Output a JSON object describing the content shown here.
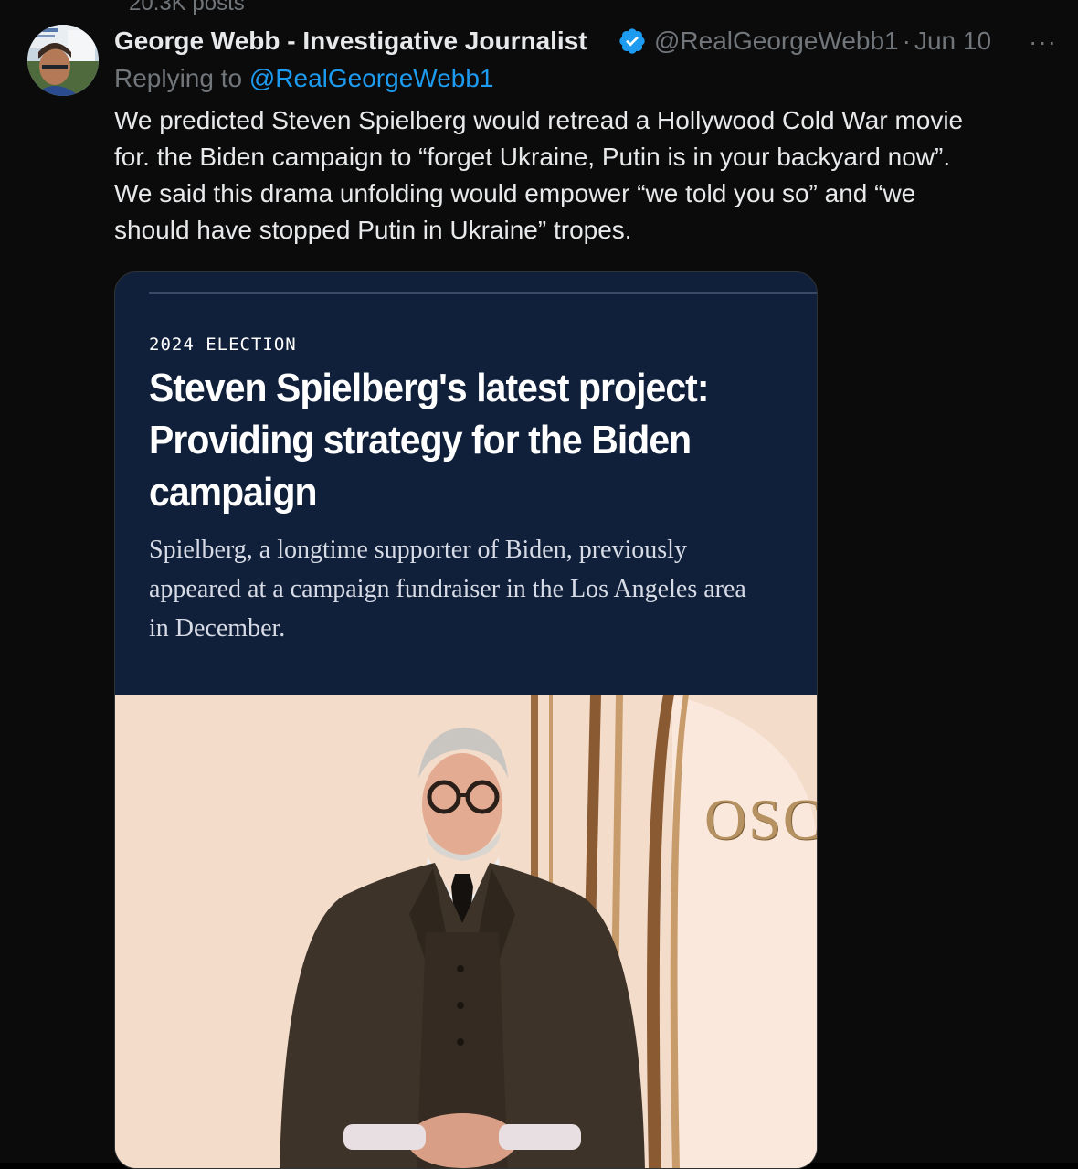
{
  "top": {
    "post_count": "20.3K posts"
  },
  "tweet": {
    "display_name": "George Webb - Investigative Journalist",
    "handle": "@RealGeorgeWebb1",
    "separator": "·",
    "date": "Jun 10",
    "more_glyph": "···",
    "reply_prefix": "Replying to ",
    "reply_mention": "@RealGeorgeWebb1",
    "body_lines": [
      "We predicted Steven Spielberg would retread a Hollywood Cold War movie",
      "for. the Biden campaign to “forget Ukraine, Putin is in your backyard now”.",
      "We said this drama unfolding would empower “we told you so” and “we",
      "should have stopped Putin in Ukraine” tropes."
    ],
    "verified_color": "#1d9bf0"
  },
  "card": {
    "kicker": "2024 ELECTION",
    "headline_lines": [
      "Steven Spielberg's latest project:",
      "Providing strategy for the Biden",
      "campaign"
    ],
    "deck_lines": [
      "Spielberg, a longtime supporter of Biden, previously",
      "appeared at a campaign fundraiser in the Los Angeles area",
      "in December."
    ],
    "photo_sign_text": "OSC",
    "background_color": "#11203a"
  }
}
